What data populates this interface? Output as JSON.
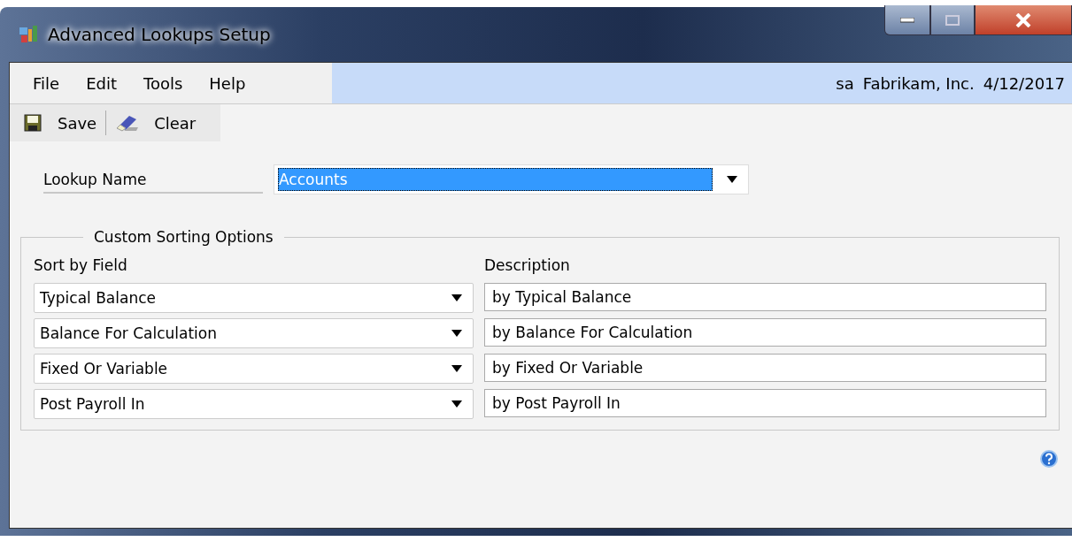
{
  "window": {
    "title": "Advanced Lookups Setup"
  },
  "menu": [
    {
      "label": "File"
    },
    {
      "label": "Edit"
    },
    {
      "label": "Tools"
    },
    {
      "label": "Help"
    }
  ],
  "session": {
    "user": "sa",
    "company": "Fabrikam, Inc.",
    "date": "4/12/2017"
  },
  "toolbar": [
    {
      "kind": "save",
      "label": "Save"
    },
    {
      "kind": "clear",
      "label": "Clear"
    }
  ],
  "lookup_name": {
    "label": "Lookup Name",
    "value": "Accounts",
    "selected": true
  },
  "sorting": {
    "title": "Custom Sorting Options",
    "columns": [
      "Sort by Field",
      "Description"
    ],
    "rows": [
      {
        "field": "Typical Balance",
        "description": "by Typical Balance"
      },
      {
        "field": "Balance For Calculation",
        "description": "by Balance For Calculation"
      },
      {
        "field": "Fixed Or Variable",
        "description": "by Fixed Or Variable"
      },
      {
        "field": "Post Payroll In",
        "description": "by Post Payroll In"
      }
    ]
  }
}
